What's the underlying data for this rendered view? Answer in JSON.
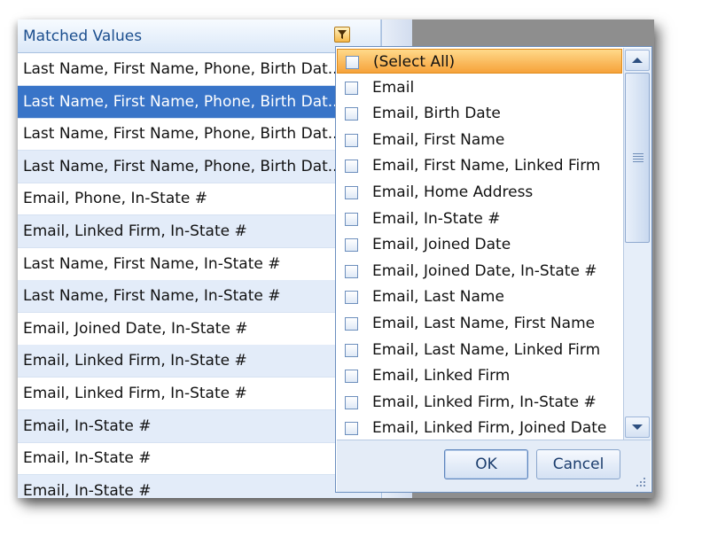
{
  "grid": {
    "header": "Matched Values",
    "rows": [
      "Last Name, First Name, Phone, Birth Dat...",
      "Last Name, First Name, Phone, Birth Dat...",
      "Last Name, First Name, Phone, Birth Dat...",
      "Last Name, First Name, Phone, Birth Dat...",
      "Email, Phone, In-State #",
      "Email, Linked Firm, In-State #",
      "Last Name, First Name, In-State #",
      "Last Name, First Name, In-State #",
      "Email, Joined Date, In-State #",
      "Email, Linked Firm, In-State #",
      "Email, Linked Firm, In-State #",
      "Email, In-State #",
      "Email, In-State #",
      "Email, In-State #"
    ],
    "selected_row": 1
  },
  "filter_popup": {
    "items": [
      "(Select All)",
      "Email",
      "Email, Birth Date",
      "Email, First Name",
      "Email, First Name, Linked Firm",
      "Email, Home Address",
      "Email, In-State #",
      "Email, Joined Date",
      "Email, Joined Date, In-State #",
      "Email, Last Name",
      "Email, Last Name, First Name",
      "Email, Last Name, Linked Firm",
      "Email, Linked Firm",
      "Email, Linked Firm, In-State #",
      "Email, Linked Firm, Joined Date"
    ],
    "highlighted_item": 0,
    "ok_label": "OK",
    "cancel_label": "Cancel"
  }
}
